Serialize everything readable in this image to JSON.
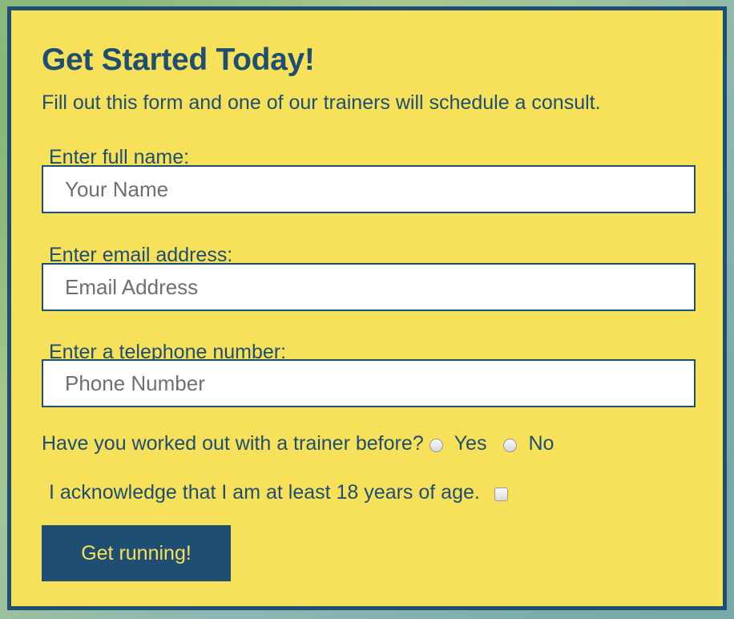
{
  "form": {
    "title": "Get Started Today!",
    "subtitle": "Fill out this form and one of our trainers will schedule a consult.",
    "fields": [
      {
        "label": "Enter full name:",
        "placeholder": "Your Name",
        "value": ""
      },
      {
        "label": "Enter email address:",
        "placeholder": "Email Address",
        "value": ""
      },
      {
        "label": "Enter a telephone number:",
        "placeholder": "Phone Number",
        "value": ""
      }
    ],
    "trainer_question": {
      "label": "Have you worked out with a trainer before?",
      "options": [
        {
          "label": "Yes",
          "selected": false
        },
        {
          "label": "No",
          "selected": false
        }
      ]
    },
    "age_acknowledgement": {
      "label": "I acknowledge that I am at least 18 years of age.",
      "checked": false
    },
    "submit_label": "Get running!"
  },
  "colors": {
    "card_background": "#f7e05a",
    "primary": "#1e4e72",
    "input_background": "#ffffff",
    "button_text": "#f7e05a"
  }
}
